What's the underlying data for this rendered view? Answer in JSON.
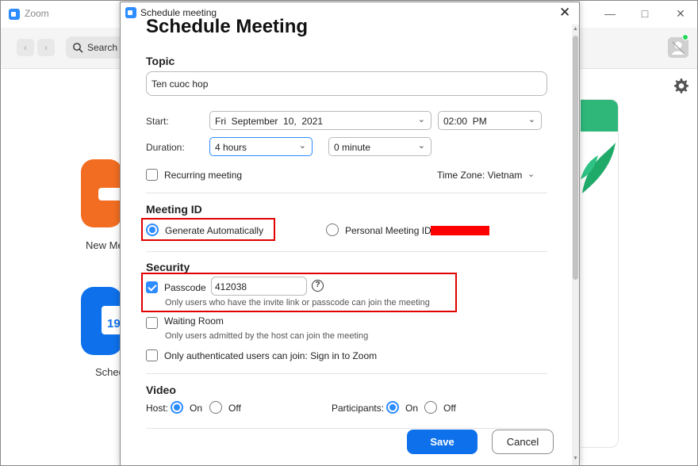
{
  "main_window": {
    "title": "Zoom",
    "search_label": "Search",
    "tiles": [
      {
        "label": "New Me"
      },
      {
        "label": "Sched",
        "calendar_day": "19"
      }
    ],
    "colors": {
      "new_meeting_tile": "#f26d21",
      "schedule_tile": "#0e71eb",
      "accent": "#2d8cff"
    }
  },
  "dialog": {
    "window_title": "Schedule meeting",
    "heading": "Schedule Meeting",
    "topic": {
      "label": "Topic",
      "value": "Ten cuoc hop"
    },
    "start": {
      "label": "Start:",
      "date": "Fri  September  10,  2021",
      "time": "02:00  PM"
    },
    "duration": {
      "label": "Duration:",
      "hours": "4 hours",
      "minutes": "0 minute"
    },
    "recurring": {
      "label": "Recurring meeting",
      "checked": false
    },
    "timezone": {
      "label": "Time Zone: Vietnam"
    },
    "meeting_id": {
      "section": "Meeting ID",
      "generate_auto": "Generate Automatically",
      "personal": "Personal Meeting ID",
      "selected": "generate_auto"
    },
    "security": {
      "section": "Security",
      "passcode_label": "Passcode",
      "passcode_value": "412038",
      "passcode_checked": true,
      "passcode_help": "Only users who have the invite link or passcode can join the meeting",
      "waiting_room_label": "Waiting Room",
      "waiting_room_checked": false,
      "waiting_room_help": "Only users admitted by the host can join the meeting",
      "auth_label": "Only authenticated users can join: Sign in to Zoom",
      "auth_checked": false
    },
    "video": {
      "section": "Video",
      "host_label": "Host:",
      "participants_label": "Participants:",
      "on": "On",
      "off": "Off",
      "host_selected": "On",
      "participants_selected": "On"
    },
    "buttons": {
      "save": "Save",
      "cancel": "Cancel"
    }
  }
}
